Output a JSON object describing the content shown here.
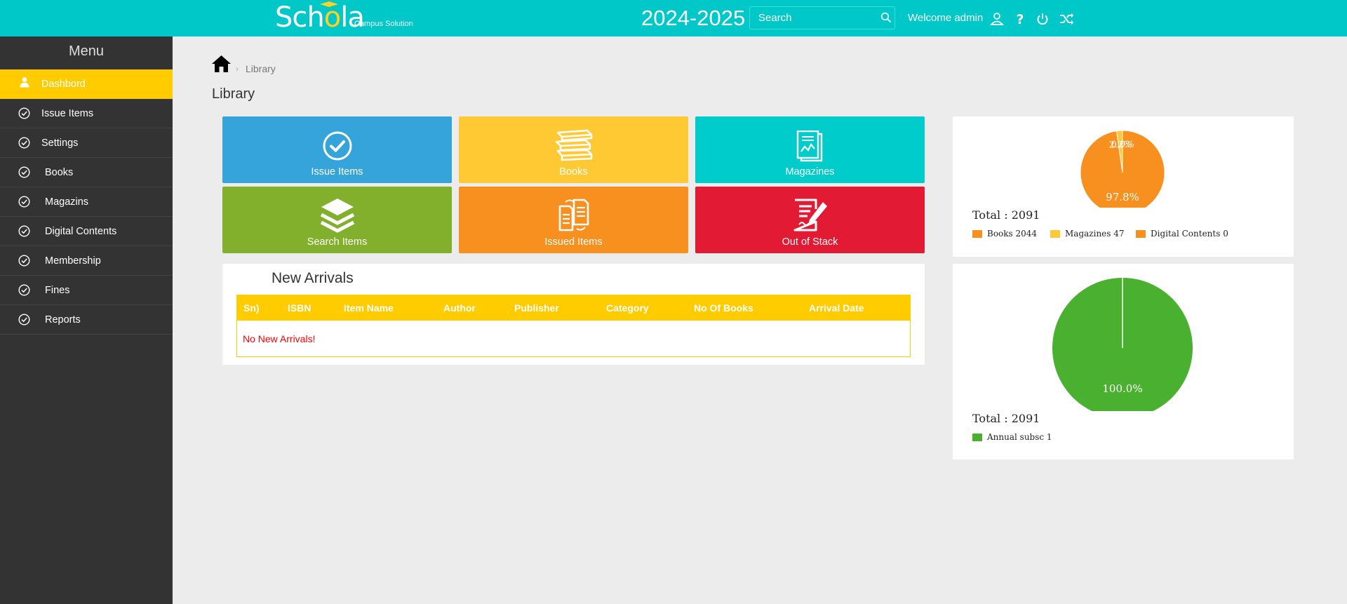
{
  "brand": {
    "logo_prefix": "Sch",
    "logo_accent": "o",
    "logo_suffix": "la",
    "logo_sub": "Campus Solution"
  },
  "header": {
    "year": "2024-2025",
    "search_placeholder": "Search",
    "welcome": "Welcome admin",
    "icons": [
      "user-icon",
      "help-icon",
      "power-icon",
      "shuffle-icon"
    ]
  },
  "sidebar": {
    "title": "Menu",
    "items": [
      {
        "label": "Dashbord",
        "icon": "user-icon"
      },
      {
        "label": "Issue Items",
        "icon": "check-circle-icon"
      },
      {
        "label": "Settings",
        "icon": "check-circle-icon"
      },
      {
        "label": "Books",
        "icon": "check-circle-icon"
      },
      {
        "label": "Magazins",
        "icon": "check-circle-icon"
      },
      {
        "label": "Digital Contents",
        "icon": "check-circle-icon"
      },
      {
        "label": "Membership",
        "icon": "check-circle-icon"
      },
      {
        "label": "Fines",
        "icon": "check-circle-icon"
      },
      {
        "label": "Reports",
        "icon": "check-circle-icon"
      }
    ]
  },
  "breadcrumb": {
    "current": "Library"
  },
  "page_title": "Library",
  "tiles": [
    {
      "label": "Issue Items",
      "icon": "check-circle-icon",
      "color": "#34a4db"
    },
    {
      "label": "Books",
      "icon": "books-icon",
      "color": "#ffc933"
    },
    {
      "label": "Magazines",
      "icon": "magazine-icon",
      "color": "#00cccc"
    },
    {
      "label": "Search Items",
      "icon": "layers-icon",
      "color": "#82b02c"
    },
    {
      "label": "Issued Items",
      "icon": "documents-icon",
      "color": "#f7901e"
    },
    {
      "label": "Out of Stack",
      "icon": "edit-document-icon",
      "color": "#e21a34"
    }
  ],
  "new_arrivals": {
    "title": "New Arrivals",
    "columns": [
      "Sn)",
      "ISBN",
      "Item Name",
      "Author",
      "Publisher",
      "Category",
      "No Of Books",
      "Arrival Date"
    ],
    "empty_message": "No New Arrivals!"
  },
  "chart_data": [
    {
      "type": "pie",
      "total_label": "Total : 2091",
      "slices": [
        {
          "name": "Books",
          "value": 2044,
          "color": "#f7901e",
          "legend": "Books 2044",
          "pct_label": "97.8%"
        },
        {
          "name": "Magazines",
          "value": 47,
          "color": "#ffc933",
          "legend": "Magazines 47",
          "pct_label": "2.2%"
        },
        {
          "name": "Digital Contents",
          "value": 0,
          "color": "#f7901e",
          "legend": "Digital Contents 0",
          "pct_label": "0.0%"
        }
      ]
    },
    {
      "type": "pie",
      "total_label": "Total : 2091",
      "slices": [
        {
          "name": "Annual subsc",
          "value": 1,
          "color": "#4ab02f",
          "legend": "Annual subsc 1",
          "pct_label": "100.0%"
        }
      ]
    }
  ]
}
